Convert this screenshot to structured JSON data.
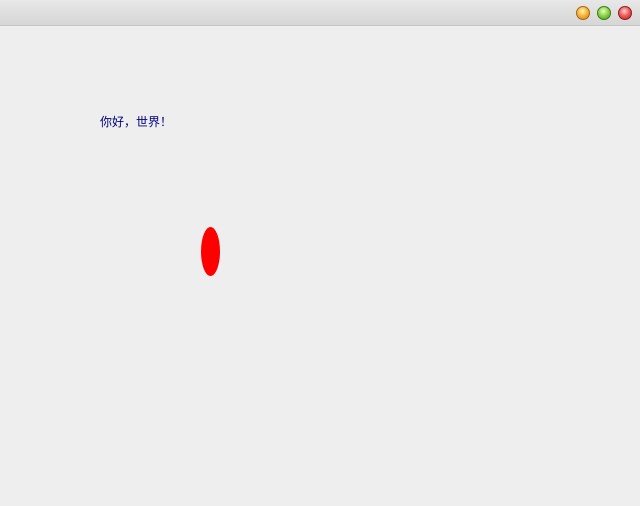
{
  "window": {
    "controls": {
      "minimize_icon": "minimize-icon",
      "maximize_icon": "maximize-icon",
      "close_icon": "close-icon",
      "minimize_color": "#f7b83a",
      "maximize_color": "#8fd44a",
      "close_color": "#f06060"
    }
  },
  "content": {
    "greeting_text": "你好，世界！",
    "text_color": "#000080",
    "ellipse_color": "#ff0000",
    "background_color": "#eeeeee"
  }
}
